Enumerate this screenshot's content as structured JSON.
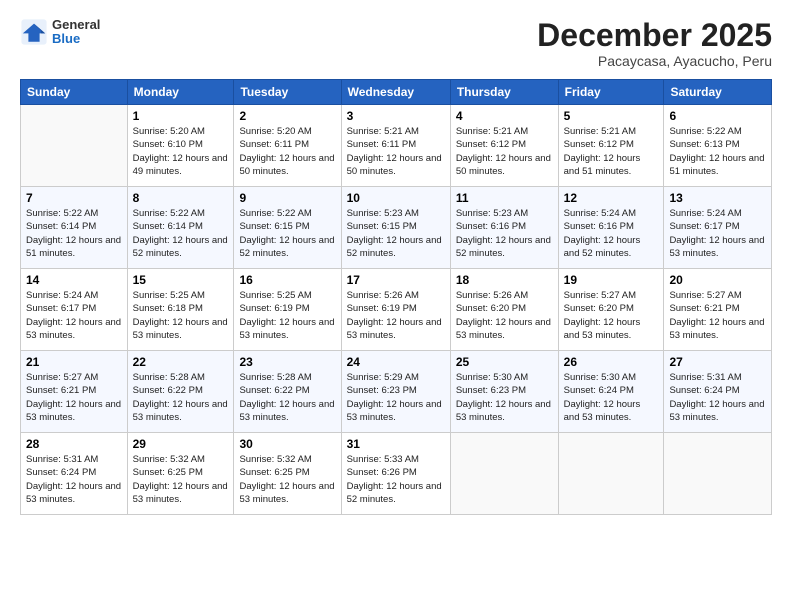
{
  "logo": {
    "general": "General",
    "blue": "Blue"
  },
  "title": "December 2025",
  "subtitle": "Pacaycasa, Ayacucho, Peru",
  "days_of_week": [
    "Sunday",
    "Monday",
    "Tuesday",
    "Wednesday",
    "Thursday",
    "Friday",
    "Saturday"
  ],
  "weeks": [
    [
      {
        "day": "",
        "sunrise": "",
        "sunset": "",
        "daylight": ""
      },
      {
        "day": "1",
        "sunrise": "5:20 AM",
        "sunset": "6:10 PM",
        "daylight": "12 hours and 49 minutes."
      },
      {
        "day": "2",
        "sunrise": "5:20 AM",
        "sunset": "6:11 PM",
        "daylight": "12 hours and 50 minutes."
      },
      {
        "day": "3",
        "sunrise": "5:21 AM",
        "sunset": "6:11 PM",
        "daylight": "12 hours and 50 minutes."
      },
      {
        "day": "4",
        "sunrise": "5:21 AM",
        "sunset": "6:12 PM",
        "daylight": "12 hours and 50 minutes."
      },
      {
        "day": "5",
        "sunrise": "5:21 AM",
        "sunset": "6:12 PM",
        "daylight": "12 hours and 51 minutes."
      },
      {
        "day": "6",
        "sunrise": "5:22 AM",
        "sunset": "6:13 PM",
        "daylight": "12 hours and 51 minutes."
      }
    ],
    [
      {
        "day": "7",
        "sunrise": "5:22 AM",
        "sunset": "6:14 PM",
        "daylight": "12 hours and 51 minutes."
      },
      {
        "day": "8",
        "sunrise": "5:22 AM",
        "sunset": "6:14 PM",
        "daylight": "12 hours and 52 minutes."
      },
      {
        "day": "9",
        "sunrise": "5:22 AM",
        "sunset": "6:15 PM",
        "daylight": "12 hours and 52 minutes."
      },
      {
        "day": "10",
        "sunrise": "5:23 AM",
        "sunset": "6:15 PM",
        "daylight": "12 hours and 52 minutes."
      },
      {
        "day": "11",
        "sunrise": "5:23 AM",
        "sunset": "6:16 PM",
        "daylight": "12 hours and 52 minutes."
      },
      {
        "day": "12",
        "sunrise": "5:24 AM",
        "sunset": "6:16 PM",
        "daylight": "12 hours and 52 minutes."
      },
      {
        "day": "13",
        "sunrise": "5:24 AM",
        "sunset": "6:17 PM",
        "daylight": "12 hours and 53 minutes."
      }
    ],
    [
      {
        "day": "14",
        "sunrise": "5:24 AM",
        "sunset": "6:17 PM",
        "daylight": "12 hours and 53 minutes."
      },
      {
        "day": "15",
        "sunrise": "5:25 AM",
        "sunset": "6:18 PM",
        "daylight": "12 hours and 53 minutes."
      },
      {
        "day": "16",
        "sunrise": "5:25 AM",
        "sunset": "6:19 PM",
        "daylight": "12 hours and 53 minutes."
      },
      {
        "day": "17",
        "sunrise": "5:26 AM",
        "sunset": "6:19 PM",
        "daylight": "12 hours and 53 minutes."
      },
      {
        "day": "18",
        "sunrise": "5:26 AM",
        "sunset": "6:20 PM",
        "daylight": "12 hours and 53 minutes."
      },
      {
        "day": "19",
        "sunrise": "5:27 AM",
        "sunset": "6:20 PM",
        "daylight": "12 hours and 53 minutes."
      },
      {
        "day": "20",
        "sunrise": "5:27 AM",
        "sunset": "6:21 PM",
        "daylight": "12 hours and 53 minutes."
      }
    ],
    [
      {
        "day": "21",
        "sunrise": "5:27 AM",
        "sunset": "6:21 PM",
        "daylight": "12 hours and 53 minutes."
      },
      {
        "day": "22",
        "sunrise": "5:28 AM",
        "sunset": "6:22 PM",
        "daylight": "12 hours and 53 minutes."
      },
      {
        "day": "23",
        "sunrise": "5:28 AM",
        "sunset": "6:22 PM",
        "daylight": "12 hours and 53 minutes."
      },
      {
        "day": "24",
        "sunrise": "5:29 AM",
        "sunset": "6:23 PM",
        "daylight": "12 hours and 53 minutes."
      },
      {
        "day": "25",
        "sunrise": "5:30 AM",
        "sunset": "6:23 PM",
        "daylight": "12 hours and 53 minutes."
      },
      {
        "day": "26",
        "sunrise": "5:30 AM",
        "sunset": "6:24 PM",
        "daylight": "12 hours and 53 minutes."
      },
      {
        "day": "27",
        "sunrise": "5:31 AM",
        "sunset": "6:24 PM",
        "daylight": "12 hours and 53 minutes."
      }
    ],
    [
      {
        "day": "28",
        "sunrise": "5:31 AM",
        "sunset": "6:24 PM",
        "daylight": "12 hours and 53 minutes."
      },
      {
        "day": "29",
        "sunrise": "5:32 AM",
        "sunset": "6:25 PM",
        "daylight": "12 hours and 53 minutes."
      },
      {
        "day": "30",
        "sunrise": "5:32 AM",
        "sunset": "6:25 PM",
        "daylight": "12 hours and 53 minutes."
      },
      {
        "day": "31",
        "sunrise": "5:33 AM",
        "sunset": "6:26 PM",
        "daylight": "12 hours and 52 minutes."
      },
      {
        "day": "",
        "sunrise": "",
        "sunset": "",
        "daylight": ""
      },
      {
        "day": "",
        "sunrise": "",
        "sunset": "",
        "daylight": ""
      },
      {
        "day": "",
        "sunrise": "",
        "sunset": "",
        "daylight": ""
      }
    ]
  ]
}
